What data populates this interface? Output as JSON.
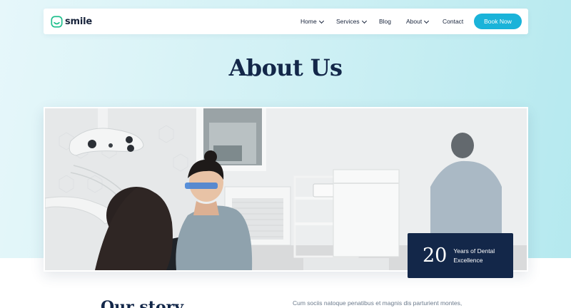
{
  "brand": {
    "name": "smile",
    "accent": "#1ab3d9",
    "dark": "#132749"
  },
  "nav": {
    "items": [
      {
        "label": "Home",
        "dropdown": true
      },
      {
        "label": "Services",
        "dropdown": true
      },
      {
        "label": "Blog",
        "dropdown": false
      },
      {
        "label": "About",
        "dropdown": true
      },
      {
        "label": "Contact",
        "dropdown": false
      }
    ],
    "cta": "Book Now"
  },
  "hero": {
    "title": "About Us"
  },
  "badge": {
    "number": "20",
    "label": "Years of Dental Excellence"
  },
  "story": {
    "heading": "Our story",
    "text": "Cum sociis natoque penatibus et magnis dis parturient montes,"
  },
  "icons": {
    "logo": "smile-face-icon",
    "dropdown": "chevron-down-icon"
  }
}
